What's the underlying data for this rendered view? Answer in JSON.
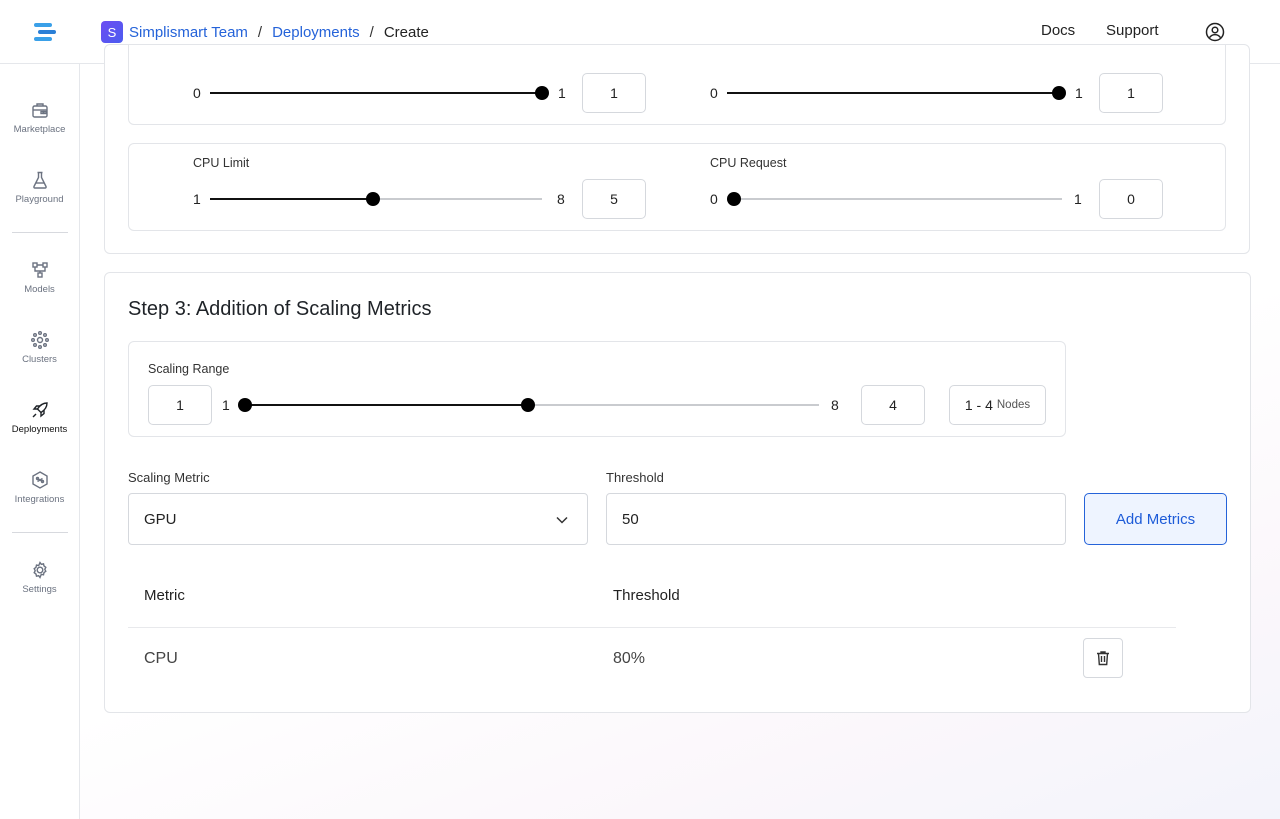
{
  "header": {
    "team_initial": "S",
    "team_name": "Simplismart Team",
    "crumb_sep_1": "/",
    "crumb_deployments": "Deployments",
    "crumb_sep_2": "/",
    "crumb_current": "Create",
    "docs": "Docs",
    "support": "Support"
  },
  "sidebar": {
    "items": [
      {
        "label": "Marketplace",
        "icon": "marketplace-icon"
      },
      {
        "label": "Playground",
        "icon": "flask-icon"
      },
      {
        "label": "Models",
        "icon": "models-icon"
      },
      {
        "label": "Clusters",
        "icon": "clusters-icon"
      },
      {
        "label": "Deployments",
        "icon": "rocket-icon",
        "active": true
      },
      {
        "label": "Integrations",
        "icon": "integrations-icon"
      },
      {
        "label": "Settings",
        "icon": "gear-icon"
      }
    ]
  },
  "resources": {
    "top_left": {
      "min": "0",
      "max": "1",
      "value": "1",
      "fraction": 1.0
    },
    "top_right": {
      "min": "0",
      "max": "1",
      "value": "1",
      "fraction": 1.0
    },
    "cpu_limit": {
      "label": "CPU Limit",
      "min": "1",
      "max": "8",
      "value": "5"
    },
    "cpu_request": {
      "label": "CPU Request",
      "min": "0",
      "max": "1",
      "value": "0"
    }
  },
  "step3": {
    "title": "Step 3: Addition of Scaling Metrics",
    "scaling_range": {
      "label": "Scaling Range",
      "low_value": "1",
      "min": "1",
      "max": "8",
      "high_value": "4",
      "summary_value": "1 - 4",
      "summary_unit": "Nodes"
    },
    "scaling_metric_label": "Scaling Metric",
    "scaling_metric_value": "GPU",
    "threshold_label": "Threshold",
    "threshold_value": "50",
    "add_button": "Add Metrics",
    "table": {
      "headers": [
        "Metric",
        "Threshold"
      ],
      "rows": [
        {
          "metric": "CPU",
          "threshold": "80%"
        }
      ]
    }
  }
}
